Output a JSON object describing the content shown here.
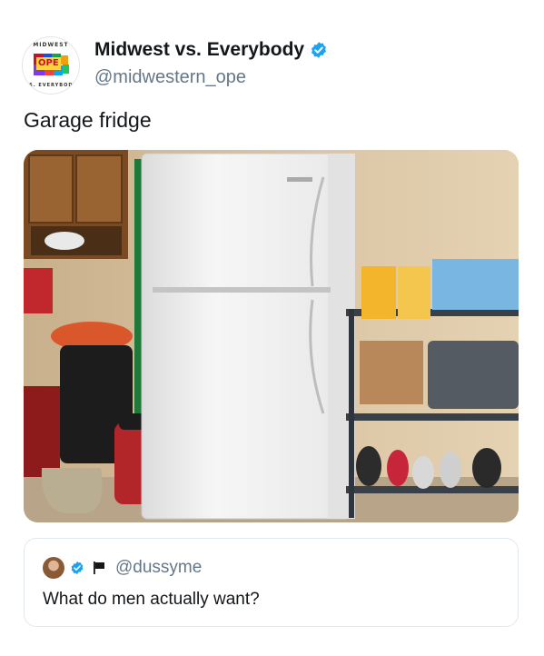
{
  "account": {
    "display_name": "Midwest vs. Everybody",
    "handle": "@midwestern_ope",
    "verified": true,
    "avatar": {
      "top_text": "MIDWEST",
      "center_text": "OPE",
      "bottom_text": "VS. EVERYBODY"
    }
  },
  "tweet": {
    "text": "Garage fridge",
    "image_subject": "white refrigerator in a garage"
  },
  "quoted_tweet": {
    "handle": "@dussyme",
    "verified": true,
    "icons": [
      "avatar",
      "verified-badge-icon",
      "flag-icon"
    ],
    "text": "What do men actually want?"
  },
  "colors": {
    "verified_blue": "#1da1f2",
    "handle_gray": "#657786",
    "text_dark": "#14171a",
    "border": "#e1e8ed"
  }
}
